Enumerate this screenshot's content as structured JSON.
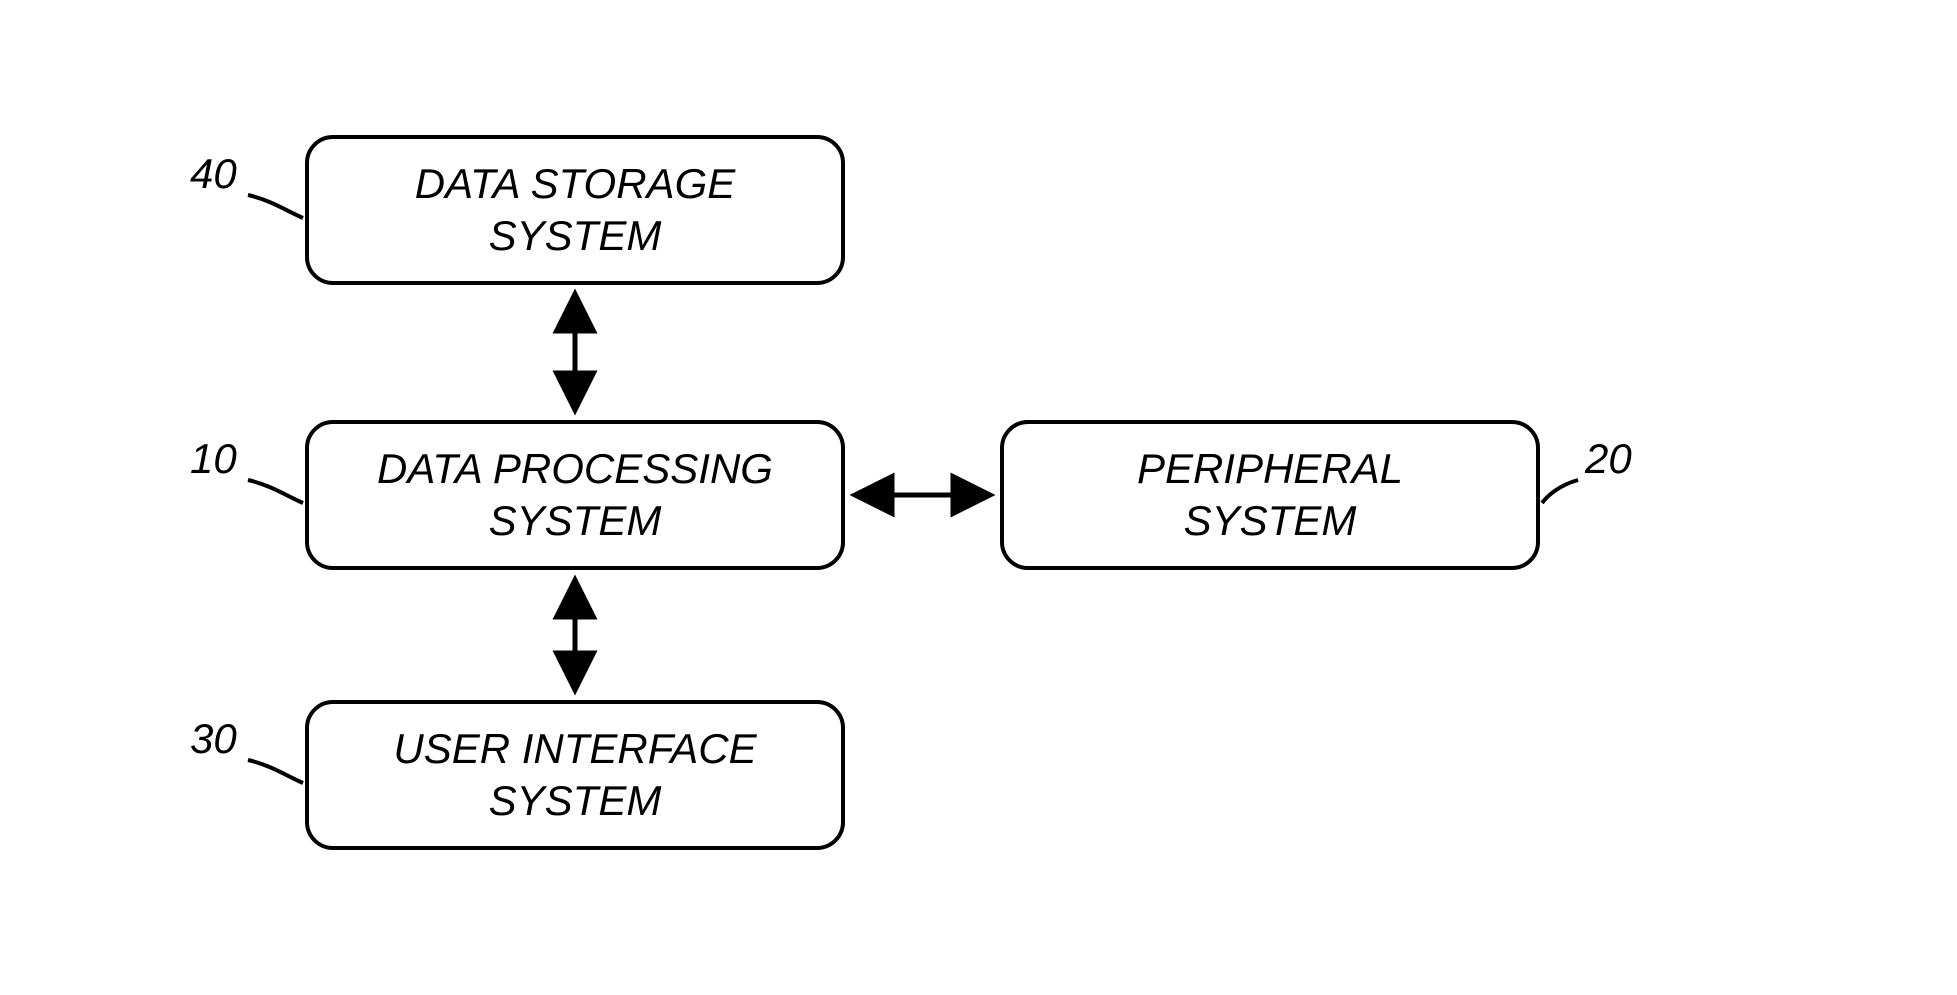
{
  "diagram": {
    "blocks": {
      "storage": {
        "label": "DATA STORAGE\nSYSTEM",
        "ref": "40"
      },
      "processing": {
        "label": "DATA PROCESSING\nSYSTEM",
        "ref": "10"
      },
      "ui": {
        "label": "USER INTERFACE\nSYSTEM",
        "ref": "30"
      },
      "peripheral": {
        "label": "PERIPHERAL\nSYSTEM",
        "ref": "20"
      }
    }
  }
}
